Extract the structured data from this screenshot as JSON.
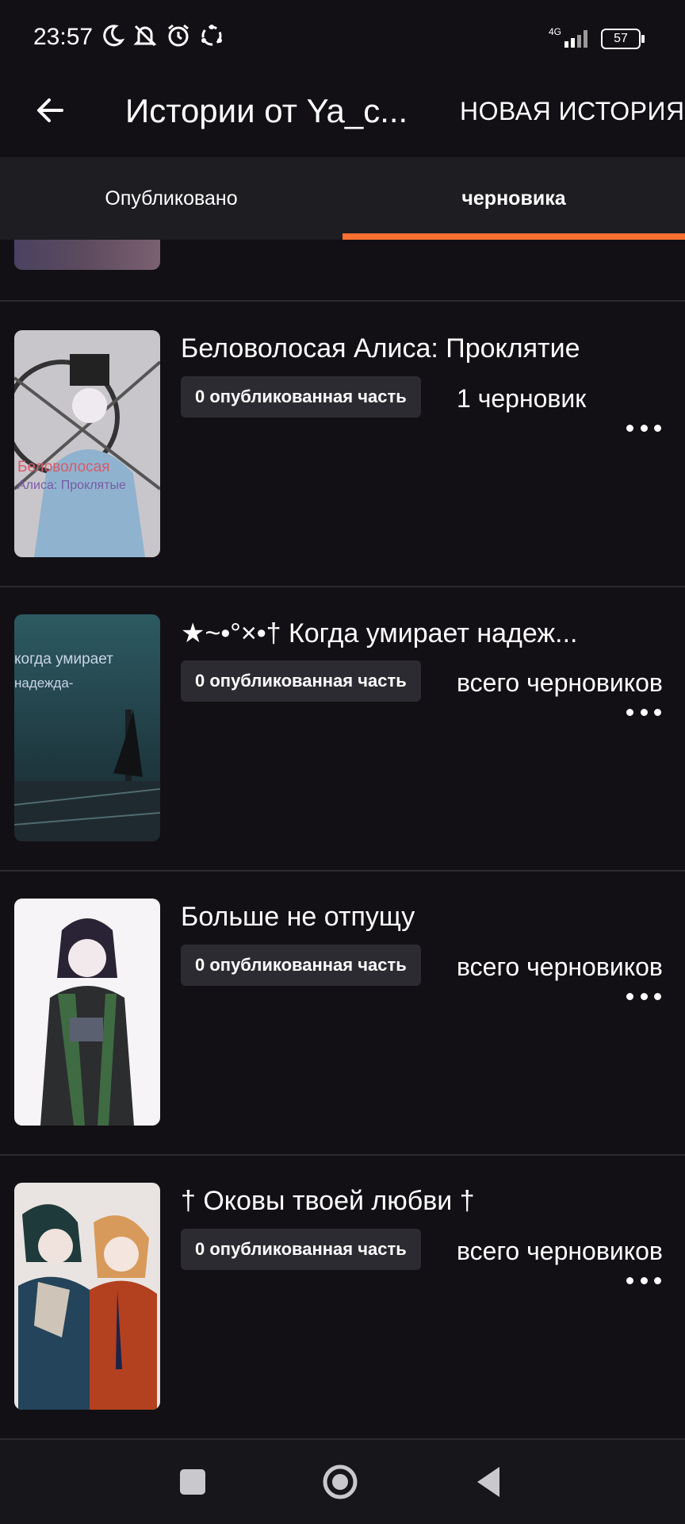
{
  "status": {
    "time": "23:57",
    "icons": [
      "moon-icon",
      "bell-off-icon",
      "alarm-icon",
      "sync-icon"
    ],
    "network": "4G",
    "battery": "57"
  },
  "appbar": {
    "title": "Истории от Ya_c...",
    "new_story": "НОВАЯ ИСТОРИЯ"
  },
  "tabs": {
    "published": "Опубликовано",
    "drafts": "черновика",
    "active_color": "#ff6f2f"
  },
  "stories": [
    {
      "title": "Беловолосая Алиса: Проклятие",
      "published": "0 опубликованная часть",
      "drafts": "1 черновик",
      "cover_text": [
        "Беловолосая",
        "Алиса: Проклятые"
      ]
    },
    {
      "title": "★~•°×•† Когда умирает надеж...",
      "published": "0 опубликованная часть",
      "drafts": "всего черновиков",
      "cover_text": [
        "когда умирает",
        "надежда-"
      ]
    },
    {
      "title": "Больше не отпущу",
      "published": "0 опубликованная часть",
      "drafts": "всего черновиков"
    },
    {
      "title": "† Оковы твоей любви †",
      "published": "0 опубликованная часть",
      "drafts": "всего черновиков"
    }
  ],
  "navbar": [
    "recents-square-icon",
    "home-circle-icon",
    "back-triangle-icon"
  ]
}
